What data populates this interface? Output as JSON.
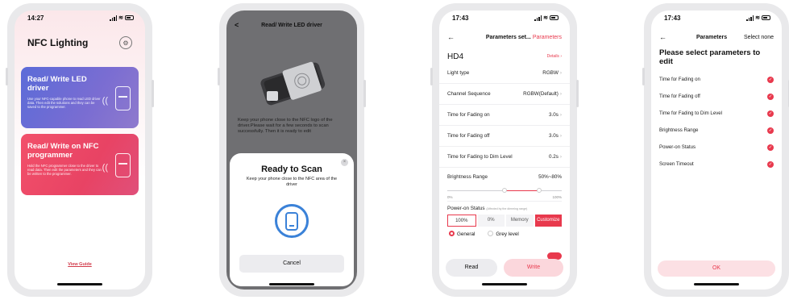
{
  "phones": [
    {
      "time": "14:27",
      "title": "NFC Lighting",
      "cards": [
        {
          "title": "Read/ Write LED driver",
          "description": "Use your NFC-capable phone to read LED driver data. Then edit the solutions and they can be saved to the programmer."
        },
        {
          "title": "Read/ Write on NFC programmer",
          "description": "Hold the NFC programmer close to the driver to read data. Then edit the parameters and they can be written to the programmer."
        }
      ],
      "view_guide": "View Guide"
    },
    {
      "title": "Read/ Write LED driver",
      "info": "Keep your phone close to the NFC logo of the driver.Please wait for a few seconds to scan successfully. Then it is ready to edit",
      "sheet": {
        "title": "Ready to Scan",
        "subtitle": "Keep your phone close to the NFC area of the driver",
        "close": "×",
        "cancel": "Cancel"
      }
    },
    {
      "time": "17:43",
      "title_prefix": "Parameters set...",
      "title_suffix": "Parameters",
      "model": "HD4",
      "details": "Details",
      "rows": [
        {
          "label": "Light type",
          "value": "RGBW"
        },
        {
          "label": "Channel Sequence",
          "value": "RGBW(Default)"
        },
        {
          "label": "Time for Fading on",
          "value": "3.0s"
        },
        {
          "label": "Time for Fading off",
          "value": "3.0s"
        },
        {
          "label": "Time for Fading to Dim Level",
          "value": "0.2s"
        }
      ],
      "brightness": {
        "label": "Brightness Range",
        "value": "50%~80%",
        "min_label": "0%",
        "max_label": "100%",
        "low": 0.5,
        "high": 0.8
      },
      "power": {
        "label": "Power-on Status",
        "note": "(Affected by the dimming range)",
        "options": [
          "100%",
          "0%",
          "Memory",
          "Customize"
        ]
      },
      "radios": [
        "General",
        "Grey level"
      ],
      "buttons": {
        "read": "Read",
        "write": "Write"
      },
      "accent": "#e8394d"
    },
    {
      "time": "17:43",
      "title": "Parameters",
      "select_none": "Select none",
      "heading": "Please select parameters to edit",
      "items": [
        "Time for Fading on",
        "Time for Fading off",
        "Time for Fading to Dim Level",
        "Brightness Range",
        "Power-on Status",
        "Screen Timeout"
      ],
      "ok": "OK"
    }
  ],
  "icons": {
    "settings": "gear-icon",
    "back": "back-arrow-icon",
    "nfc": "nfc-waves-icon",
    "check": "check-icon",
    "close": "close-icon"
  }
}
